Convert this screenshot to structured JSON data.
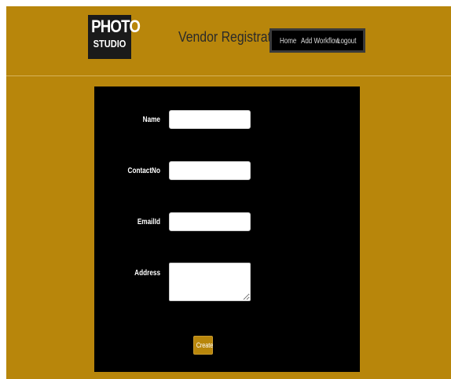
{
  "header": {
    "logo": {
      "line1": "PHOTO",
      "line2": "STUDIO"
    },
    "title": "Vendor Registration",
    "nav": [
      "Home",
      "Add Workflow",
      "Logout"
    ]
  },
  "form": {
    "fields": [
      {
        "label": "Name",
        "value": "",
        "placeholder": ""
      },
      {
        "label": "ContactNo",
        "value": "",
        "placeholder": ""
      },
      {
        "label": "EmailId",
        "value": "",
        "placeholder": ""
      },
      {
        "label": "Address",
        "value": "",
        "placeholder": ""
      }
    ],
    "submit_label": "Create"
  },
  "colors": {
    "background": "#b8860b",
    "panel": "#000000",
    "nav_background": "#000000",
    "button": "#b8860b"
  }
}
